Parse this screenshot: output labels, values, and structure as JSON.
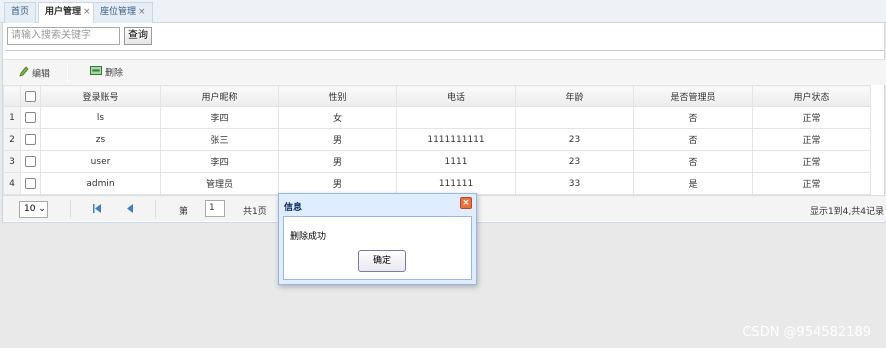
{
  "tabs": [
    {
      "label": "首页",
      "closable": false
    },
    {
      "label": "用户管理",
      "closable": true
    },
    {
      "label": "座位管理",
      "closable": true
    }
  ],
  "search": {
    "placeholder": "请输入搜索关键字",
    "button": "查询"
  },
  "toolbar": {
    "edit_label": "编辑",
    "delete_label": "删除"
  },
  "table": {
    "headers": [
      "登录账号",
      "用户昵称",
      "性别",
      "电话",
      "年龄",
      "是否管理员",
      "用户状态"
    ],
    "rows": [
      {
        "n": "1",
        "account": "ls",
        "nickname": "李四",
        "gender": "女",
        "phone": "",
        "age": "",
        "admin": "否",
        "status": "正常"
      },
      {
        "n": "2",
        "account": "zs",
        "nickname": "张三",
        "gender": "男",
        "phone": "1111111111",
        "age": "23",
        "admin": "否",
        "status": "正常"
      },
      {
        "n": "3",
        "account": "user",
        "nickname": "李四",
        "gender": "男",
        "phone": "1111",
        "age": "23",
        "admin": "否",
        "status": "正常"
      },
      {
        "n": "4",
        "account": "admin",
        "nickname": "管理员",
        "gender": "男",
        "phone": "111111",
        "age": "33",
        "admin": "是",
        "status": "正常"
      }
    ]
  },
  "pager": {
    "page_size": "10",
    "page_prefix": "第",
    "page_number": "1",
    "page_total": "共1页",
    "info": "显示1到4,共4记录"
  },
  "dialog": {
    "title": "信息",
    "message": "删除成功",
    "ok_label": "确定"
  },
  "watermark": "CSDN @954582189"
}
